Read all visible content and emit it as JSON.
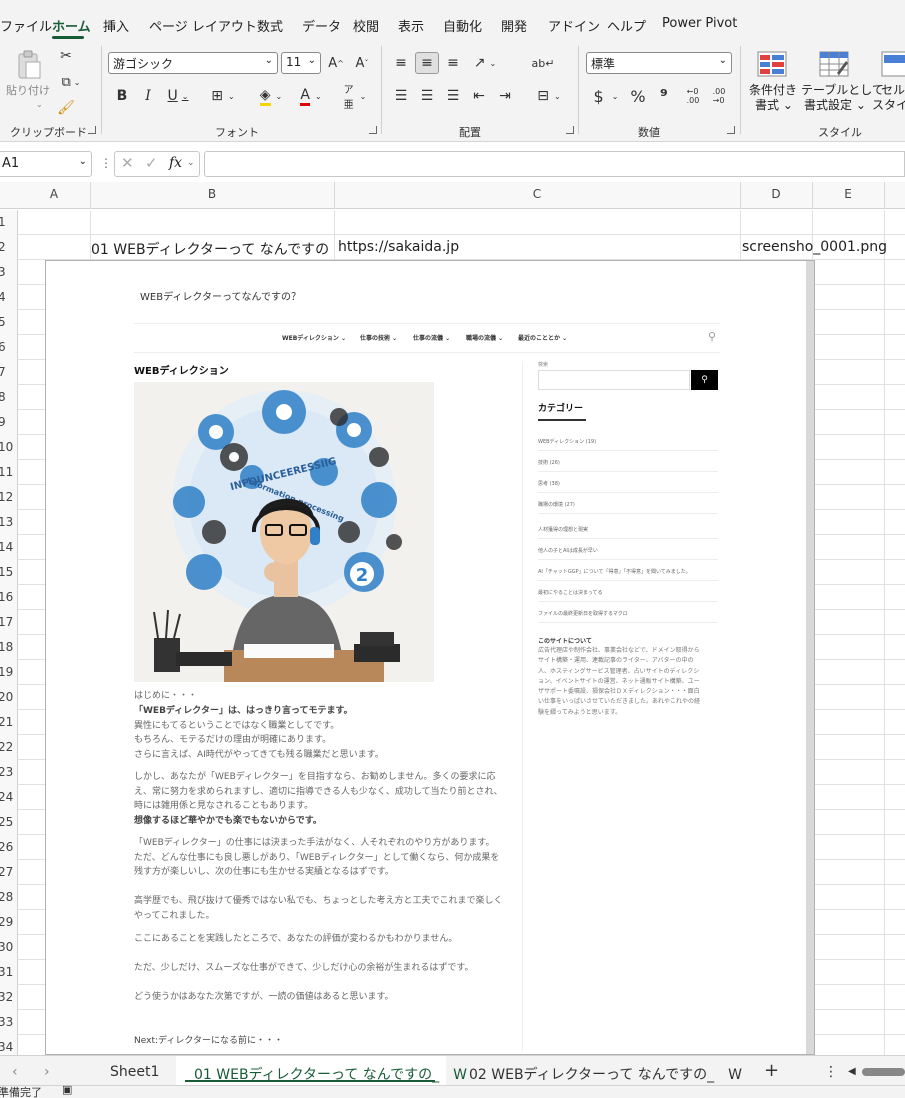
{
  "menu": {
    "tabs": [
      "ファイル",
      "ホーム",
      "挿入",
      "ページ レイアウト",
      "数式",
      "データ",
      "校閲",
      "表示",
      "自動化",
      "開発",
      "アドイン",
      "ヘルプ",
      "Power Pivot"
    ],
    "active": "ホーム"
  },
  "ribbon": {
    "clipboard": {
      "paste_label": "貼り付け",
      "group_label": "クリップボード"
    },
    "font": {
      "font_name": "游ゴシック",
      "font_size": "11",
      "group_label": "フォント"
    },
    "alignment": {
      "group_label": "配置"
    },
    "number": {
      "format": "標準",
      "group_label": "数値"
    },
    "styles": {
      "conditional_line1": "条件付き",
      "conditional_line2": "書式",
      "table_line1": "テーブルとして",
      "table_line2": "書式設定",
      "cell_line1": "セル",
      "cell_line2": "スタイル",
      "group_label": "スタイル"
    }
  },
  "formula_bar": {
    "name_box": "A1",
    "fx_label": "fx",
    "formula": ""
  },
  "columns": [
    "A",
    "B",
    "C",
    "D",
    "E"
  ],
  "rows": [
    "1",
    "2",
    "3",
    "4",
    "5",
    "6",
    "7",
    "8",
    "9",
    "10",
    "11",
    "12",
    "13",
    "14",
    "15",
    "16",
    "17",
    "18",
    "19",
    "20",
    "21",
    "22",
    "23",
    "24",
    "25",
    "26",
    "27",
    "28",
    "29",
    "30",
    "31",
    "32",
    "33",
    "34"
  ],
  "cells": {
    "B2": "01 WEBディレクターって なんですの",
    "C2": "https://sakaida.jp",
    "D2": "screensho_0001.png"
  },
  "embedded_page": {
    "site_title": "WEBディレクターってなんですの？",
    "nav": [
      "WEBディレクション ⌄",
      "仕事の技術 ⌄",
      "仕事の流儀 ⌄",
      "職場の流儀 ⌄",
      "最近のこととか ⌄"
    ],
    "heading": "WEBディレクション",
    "hero_text_top": "INFOUNCEERESSIIG",
    "hero_text_ring": "Information processing",
    "hero_number": "2",
    "paragraphs": [
      "はじめに・・・",
      "「WEBディレクター」は、はっきり言ってモテます。",
      "異性にもてるということではなく職業としてです。",
      "もちろん、モテるだけの理由が明確にあります。",
      "さらに言えば、AI時代がやってきても残る職業だと思います。",
      "しかし、あなたが「WEBディレクター」を目指すなら、お勧めしません。多くの要求に応",
      "え、常に努力を求められますし、適切に指導できる人も少なく、成功して当たり前とされ、",
      "時には雑用係と見なされることもあります。",
      "想像するほど華やかでも楽でもないからです。",
      "「WEBディレクター」の仕事には決まった手法がなく、人それぞれのやり方があります。",
      "ただ、どんな仕事にも良し悪しがあり、「WEBディレクター」として働くなら、何か成果を",
      "残す方が楽しいし、次の仕事にも生かせる実績となるはずです。",
      "高学歴でも、飛び抜けて優秀ではない私でも、ちょっとした考え方と工夫でこれまで楽しく",
      "やってこれました。",
      "ここにあることを実践したところで、あなたの評価が変わるかもわかりません。",
      "ただ、少しだけ、スムーズな仕事ができて、少しだけ心の余裕が生まれるはずです。",
      "どう使うかはあなた次第ですが、一読の価値はあると思います。",
      "Next:ディレクターになる前に・・・"
    ],
    "sidebar": {
      "search_label": "検索",
      "category_heading": "カテゴリー",
      "categories": [
        "WEBディレクション (19)",
        "技術 (26)",
        "思考 (38)",
        "職場の環境 (27)"
      ],
      "recent": [
        "人材獲得の理想と現実",
        "他人の子とAIは成長が早い",
        "AI「チャットGGP」について「得意」「不得意」を聞いてみました。",
        "最初にやることは決まってる",
        "ファイルの最終更新日を取得するマクロ"
      ],
      "about_heading": "このサイトについて",
      "about_lines": [
        "広告代理店や制作会社、事業会社などで、ドメイン取得から",
        "サイト構築・運用、連載記事のライター、アバターの中の",
        "人、ホスティングサービス管理者、占いサイトのディレクシ",
        "ョン、イベントサイトの運営、ネット通販サイト構築、ユー",
        "ザサポート委嘱設、損保会社ＤＸディレクション・・・面白",
        "い仕事をいっぱいさせていただきました。あれやこれやの経",
        "験を綴ってみようと思います。"
      ]
    }
  },
  "sheet_tabs": [
    "Sheet1",
    "01 WEBディレクターって なんですの_　W",
    "02 WEBディレクターって なんですの_　W"
  ],
  "active_sheet": "01 WEBディレクターって なんですの_　W",
  "add_sheet": "+",
  "status": "準備完了",
  "colors": {
    "accent": "#185c37",
    "ribbon_bg": "#f3f3f3",
    "font_color_bar": "#e00000"
  }
}
